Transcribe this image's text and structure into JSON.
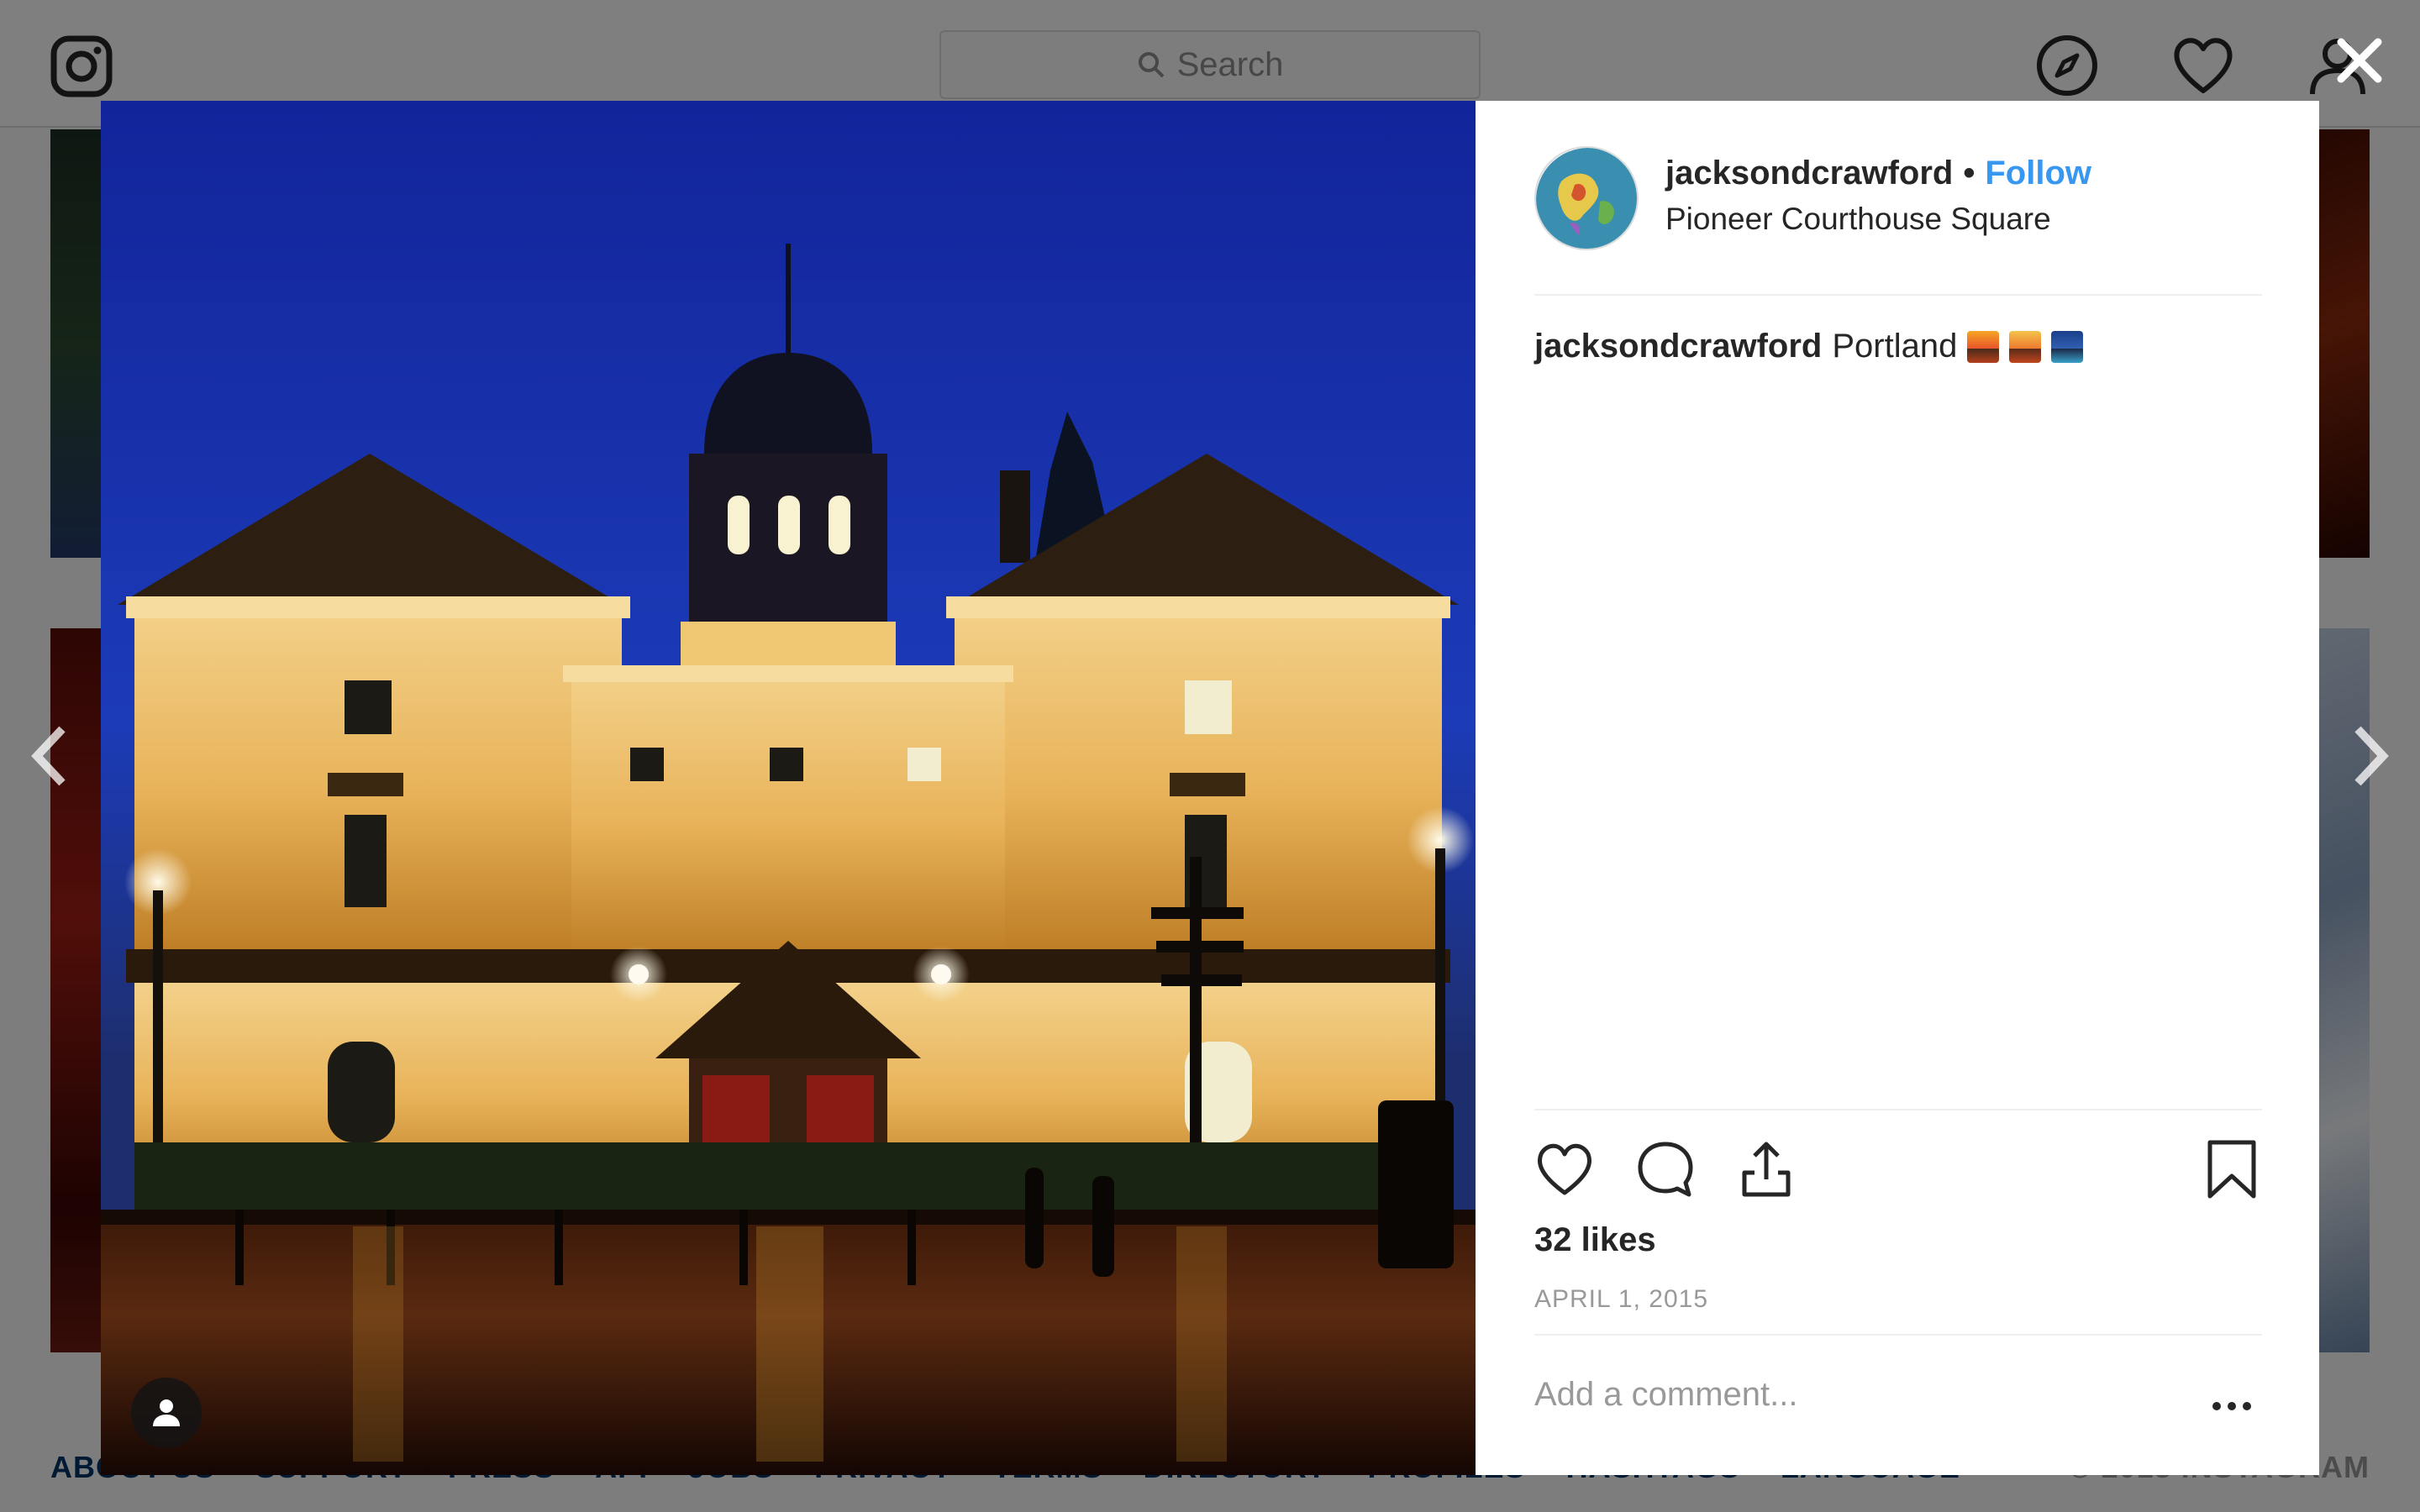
{
  "topbar": {
    "search_placeholder": "Search"
  },
  "post": {
    "username": "jacksondcrawford",
    "separator": "•",
    "follow_label": "Follow",
    "location": "Pioneer Courthouse Square",
    "caption_user": "jacksondcrawford",
    "caption_text": "Portland",
    "caption_emojis": [
      "sunset-cityscape-emoji",
      "sunrise-cityscape-emoji",
      "night-cityscape-emoji"
    ],
    "likes": "32 likes",
    "date": "APRIL 1, 2015",
    "comment_placeholder": "Add a comment...",
    "more_label": "..."
  },
  "footer": {
    "links": [
      "ABOUT US",
      "SUPPORT",
      "PRESS",
      "API",
      "JOBS",
      "PRIVACY",
      "TERMS",
      "DIRECTORY",
      "PROFILES",
      "HASHTAGS",
      "LANGUAGE"
    ],
    "copyright": "© 2018 INSTAGRAM"
  },
  "icons": {
    "logo": "instagram-icon",
    "explore": "compass-icon",
    "activity": "heart-icon",
    "profile": "person-icon",
    "close": "close-icon",
    "like": "heart-icon",
    "comment": "comment-bubble-icon",
    "share": "share-icon",
    "save": "bookmark-icon",
    "tag": "person-tag-icon"
  },
  "colors": {
    "follow": "#3897f0",
    "text": "#262626",
    "muted": "#999999",
    "overlay": "rgba(0,0,0,0.5)"
  }
}
